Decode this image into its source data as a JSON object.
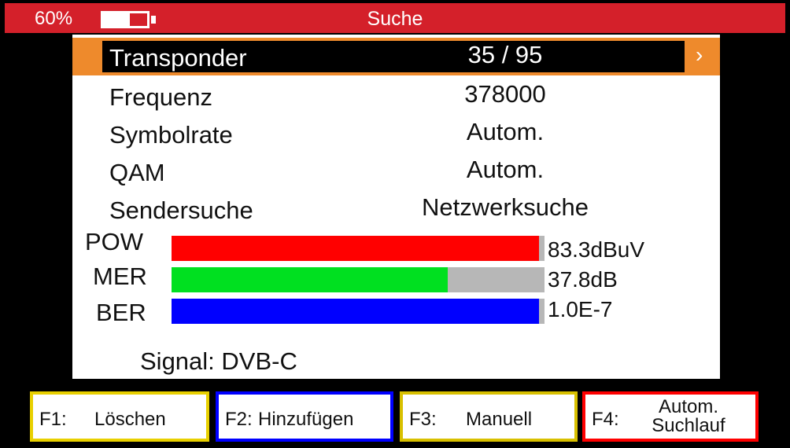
{
  "status": {
    "battery_percent_label": "60%",
    "battery_level": 0.6
  },
  "header": {
    "title": "Suche"
  },
  "settings": [
    {
      "label": "Transponder",
      "value": "35 / 95",
      "selected": true
    },
    {
      "label": "Frequenz",
      "value": "378000"
    },
    {
      "label": "Symbolrate",
      "value": "Autom."
    },
    {
      "label": "QAM",
      "value": "Autom."
    },
    {
      "label": "Sendersuche",
      "value": "Netzwerksuche"
    }
  ],
  "meters": [
    {
      "label": "POW",
      "value": "83.3dBuV",
      "level": 0.985,
      "color": "#ff0000"
    },
    {
      "label": "MER",
      "value": "37.8dB",
      "level": 0.74,
      "color": "#00e020"
    },
    {
      "label": "BER",
      "value": "1.0E-7",
      "level": 0.985,
      "color": "#0000ff"
    }
  ],
  "signal": {
    "label": "Signal: DVB-C"
  },
  "function_keys": [
    {
      "key": "F1:",
      "label": "Löschen",
      "color": "#e8d000"
    },
    {
      "key": "F2:",
      "label": "Hinzufügen",
      "color": "#0000ff"
    },
    {
      "key": "F3:",
      "label": "Manuell",
      "color": "#d8c000"
    },
    {
      "key": "F4:",
      "label_line1": "Autom.",
      "label_line2": "Suchlauf",
      "color": "#ff0000"
    }
  ],
  "icons": {
    "selection_arrow": "chevron-right-icon",
    "battery": "battery-icon"
  }
}
